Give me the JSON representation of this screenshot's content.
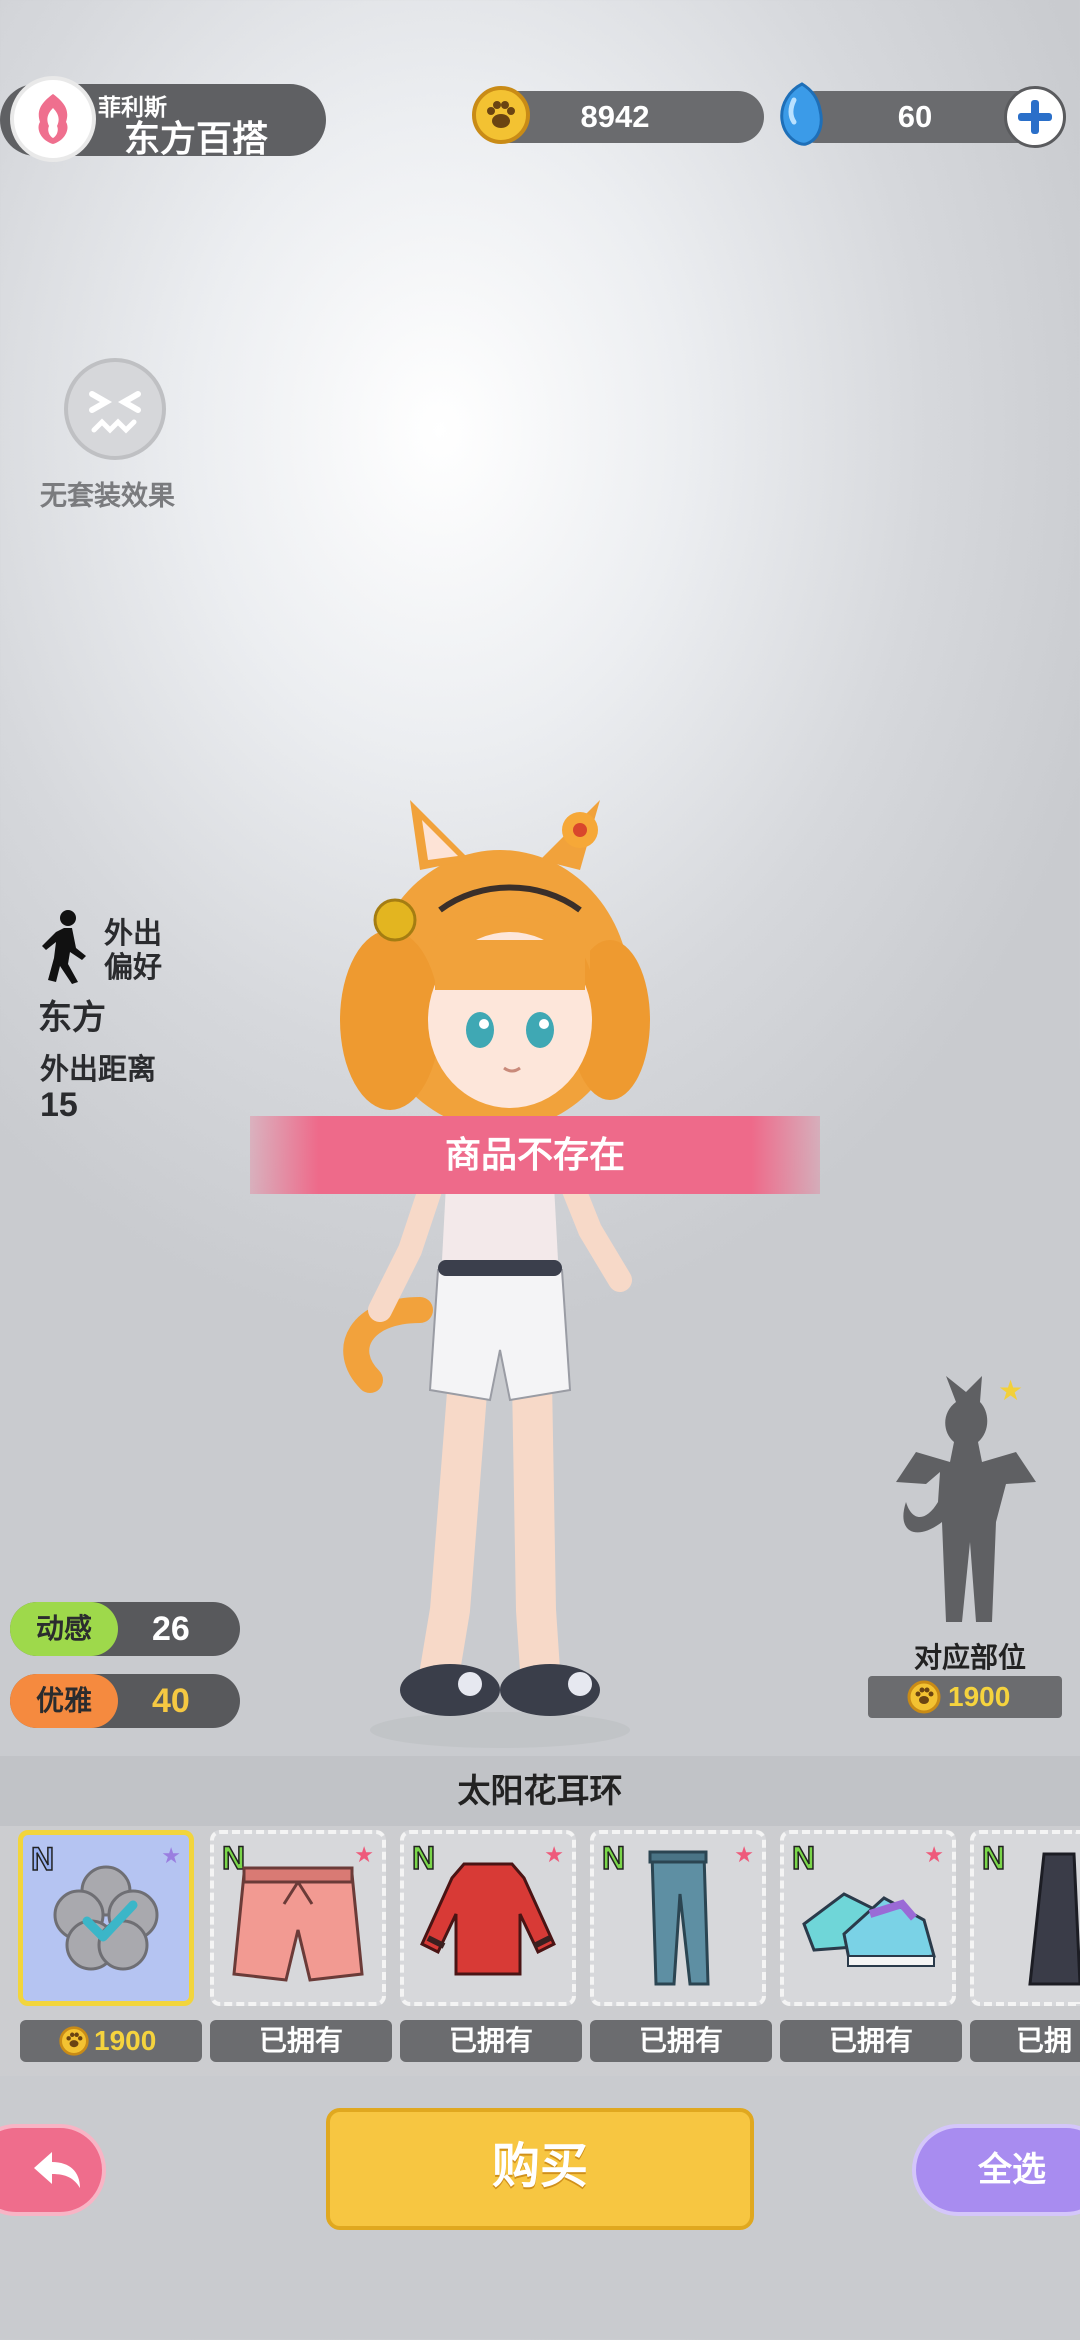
{
  "shop": {
    "owner": "菲利斯",
    "name": "东方百搭"
  },
  "currency": {
    "paw_coins": "8942",
    "gems": "60"
  },
  "set_effect": {
    "label": "无套装效果"
  },
  "outing": {
    "pref_line1": "外出",
    "pref_line2": "偏好",
    "direction": "东方",
    "distance_label": "外出距离",
    "distance_value": "15"
  },
  "stats": [
    {
      "name": "动感",
      "value": "26",
      "color": "#9ed94b"
    },
    {
      "name": "优雅",
      "value": "40",
      "color": "#f58a3f"
    }
  ],
  "toast": "商品不存在",
  "body_part": {
    "label": "对应部位",
    "price": "1900"
  },
  "selected_item_name": "太阳花耳环",
  "items": [
    {
      "rarity": "N",
      "name": "earring",
      "price": "1900",
      "status": "",
      "selected": true,
      "icon": "flower-earring-icon"
    },
    {
      "rarity": "N",
      "name": "shorts",
      "price": "",
      "status": "已拥有",
      "icon": "pink-shorts-icon"
    },
    {
      "rarity": "N",
      "name": "sweater",
      "price": "",
      "status": "已拥有",
      "icon": "red-sweater-icon"
    },
    {
      "rarity": "N",
      "name": "jeans",
      "price": "",
      "status": "已拥有",
      "icon": "jeans-icon"
    },
    {
      "rarity": "N",
      "name": "sneakers",
      "price": "",
      "status": "已拥有",
      "icon": "sneakers-icon"
    },
    {
      "rarity": "N",
      "name": "dress",
      "price": "",
      "status": "已拥",
      "icon": "dark-dress-icon"
    }
  ],
  "buttons": {
    "buy": "购买",
    "select_all": "全选"
  },
  "colors": {
    "buy": "#f7c641",
    "back": "#ef6d8c",
    "select_all": "#a88cf0",
    "toast": "#ee6a8a"
  }
}
